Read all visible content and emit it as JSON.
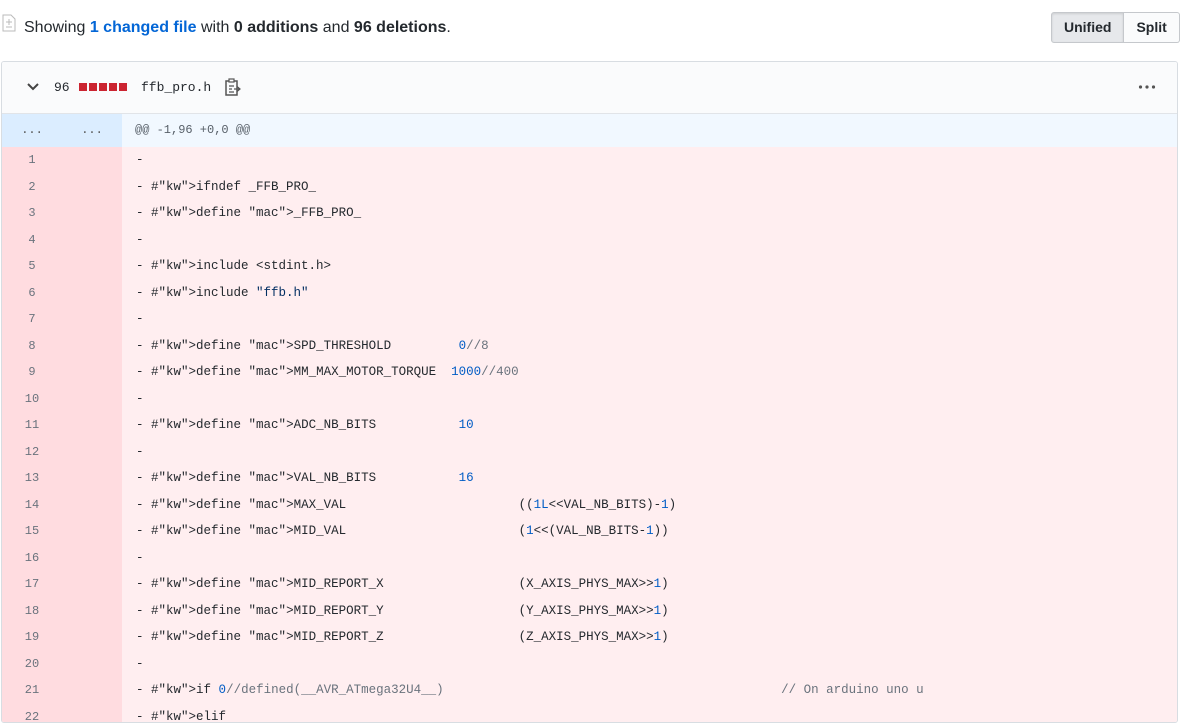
{
  "summary": {
    "prefix": "Showing ",
    "changed_files": "1 changed file",
    "mid1": " with ",
    "additions": "0 additions",
    "mid2": " and ",
    "deletions": "96 deletions",
    "suffix": "."
  },
  "view_toggle": {
    "unified": "Unified",
    "split": "Split"
  },
  "file": {
    "change_count": "96",
    "name": "ffb_pro.h",
    "icons": [
      "file-diff-icon",
      "chevron-down-icon",
      "clipboard-icon",
      "ellipsis-icon"
    ]
  },
  "hunk": {
    "left": "...",
    "right": "...",
    "header": "@@ -1,96 +0,0 @@"
  },
  "lines": [
    {
      "n": "1"
    },
    {
      "n": "2"
    },
    {
      "n": "3"
    },
    {
      "n": "4"
    },
    {
      "n": "5"
    },
    {
      "n": "6"
    },
    {
      "n": "7"
    },
    {
      "n": "8"
    },
    {
      "n": "9"
    },
    {
      "n": "10"
    },
    {
      "n": "11"
    },
    {
      "n": "12"
    },
    {
      "n": "13"
    },
    {
      "n": "14"
    },
    {
      "n": "15"
    },
    {
      "n": "16"
    },
    {
      "n": "17"
    },
    {
      "n": "18"
    },
    {
      "n": "19"
    },
    {
      "n": "20"
    },
    {
      "n": "21"
    },
    {
      "n": "22"
    }
  ],
  "code_text": [
    "-",
    "- #ifndef _FFB_PRO_",
    "- #define _FFB_PRO_",
    "-",
    "- #include <stdint.h>",
    "- #include \"ffb.h\"",
    "-",
    "- #define SPD_THRESHOLD         0//8",
    "- #define MM_MAX_MOTOR_TORQUE  1000//400",
    "-",
    "- #define ADC_NB_BITS           10",
    "-",
    "- #define VAL_NB_BITS           16",
    "- #define MAX_VAL                       ((1L<<VAL_NB_BITS)-1)",
    "- #define MID_VAL                       (1<<(VAL_NB_BITS-1))",
    "-",
    "- #define MID_REPORT_X                  (X_AXIS_PHYS_MAX>>1)",
    "- #define MID_REPORT_Y                  (Y_AXIS_PHYS_MAX>>1)",
    "- #define MID_REPORT_Z                  (Z_AXIS_PHYS_MAX>>1)",
    "-",
    "- #if 0//defined(__AVR_ATmega32U4__)                                             // On arduino uno u",
    "- #elif"
  ],
  "colors": {
    "deleted_bg": "#ffeef0",
    "deleted_gutter": "#ffdce0",
    "hunk_bg": "#f1f8ff",
    "hunk_gutter": "#dbedff",
    "link": "#0366d6",
    "deletion_block": "#cb2431"
  }
}
